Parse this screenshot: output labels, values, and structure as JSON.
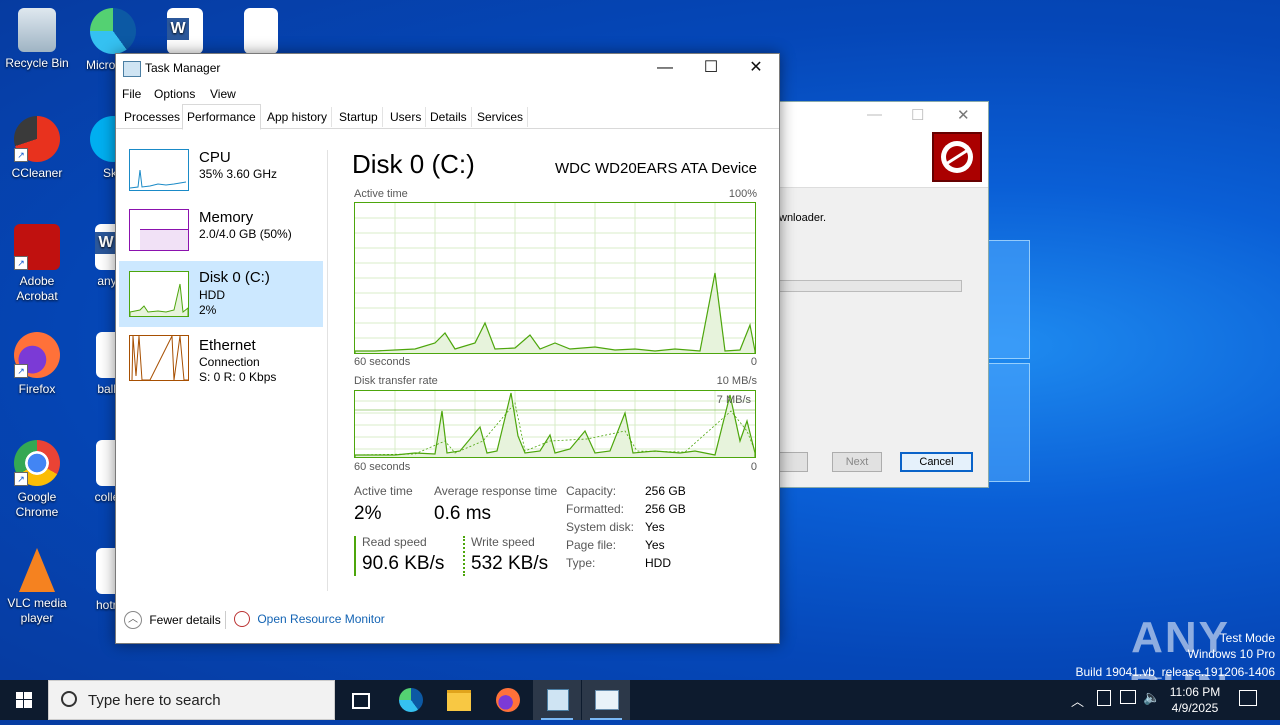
{
  "desktop": {
    "icons": [
      {
        "label": "Recycle Bin"
      },
      {
        "label": "CCleaner"
      },
      {
        "label": "Adobe Acrobat"
      },
      {
        "label": "Firefox"
      },
      {
        "label": "Google Chrome"
      },
      {
        "label": "VLC media player"
      },
      {
        "label": "Micro Edg"
      },
      {
        "label": "Sky"
      },
      {
        "label": "anysc"
      },
      {
        "label": "ballfol"
      },
      {
        "label": "collecti"
      },
      {
        "label": "hotrea"
      }
    ],
    "watermark": {
      "brand": "ANY RUN",
      "test_mode": "Test Mode",
      "edition": "Windows 10 Pro",
      "build": "Build 19041.vb_release.191206-1406"
    }
  },
  "background_dialog": {
    "text": "wnloader.",
    "next_label": "Next",
    "cancel_label": "Cancel"
  },
  "task_manager": {
    "title": "Task Manager",
    "menu": [
      "File",
      "Options",
      "View"
    ],
    "tabs": [
      "Processes",
      "Performance",
      "App history",
      "Startup",
      "Users",
      "Details",
      "Services"
    ],
    "active_tab": "Performance",
    "sidebar": [
      {
        "name": "CPU",
        "line1": "35%  3.60 GHz",
        "line2": "",
        "color": "#1a8ac7"
      },
      {
        "name": "Memory",
        "line1": "2.0/4.0 GB (50%)",
        "line2": "",
        "color": "#8b12ae"
      },
      {
        "name": "Disk 0 (C:)",
        "line1": "HDD",
        "line2": "2%",
        "color": "#4da60c"
      },
      {
        "name": "Ethernet",
        "line1": "Connection",
        "line2": "S: 0  R: 0 Kbps",
        "color": "#a74f01"
      }
    ],
    "selected_item": "Disk 0 (C:)",
    "detail": {
      "title": "Disk 0 (C:)",
      "device": "WDC WD20EARS ATA Device",
      "graph1": {
        "label": "Active time",
        "max": "100%",
        "time": "60 seconds",
        "min": "0"
      },
      "graph2": {
        "label": "Disk transfer rate",
        "max": "10 MB/s",
        "marker": "7 MB/s",
        "time": "60 seconds",
        "min": "0"
      },
      "active_time_label": "Active time",
      "active_time_value": "2%",
      "avg_response_label": "Average response time",
      "avg_response_value": "0.6 ms",
      "read_label": "Read speed",
      "read_value": "90.6 KB/s",
      "write_label": "Write speed",
      "write_value": "532 KB/s",
      "props": [
        {
          "k": "Capacity:",
          "v": "256 GB"
        },
        {
          "k": "Formatted:",
          "v": "256 GB"
        },
        {
          "k": "System disk:",
          "v": "Yes"
        },
        {
          "k": "Page file:",
          "v": "Yes"
        },
        {
          "k": "Type:",
          "v": "HDD"
        }
      ]
    },
    "footer": {
      "fewer_details": "Fewer details",
      "open_monitor": "Open Resource Monitor"
    }
  },
  "taskbar": {
    "search_placeholder": "Type here to search",
    "time": "11:06 PM",
    "date": "4/9/2025"
  }
}
